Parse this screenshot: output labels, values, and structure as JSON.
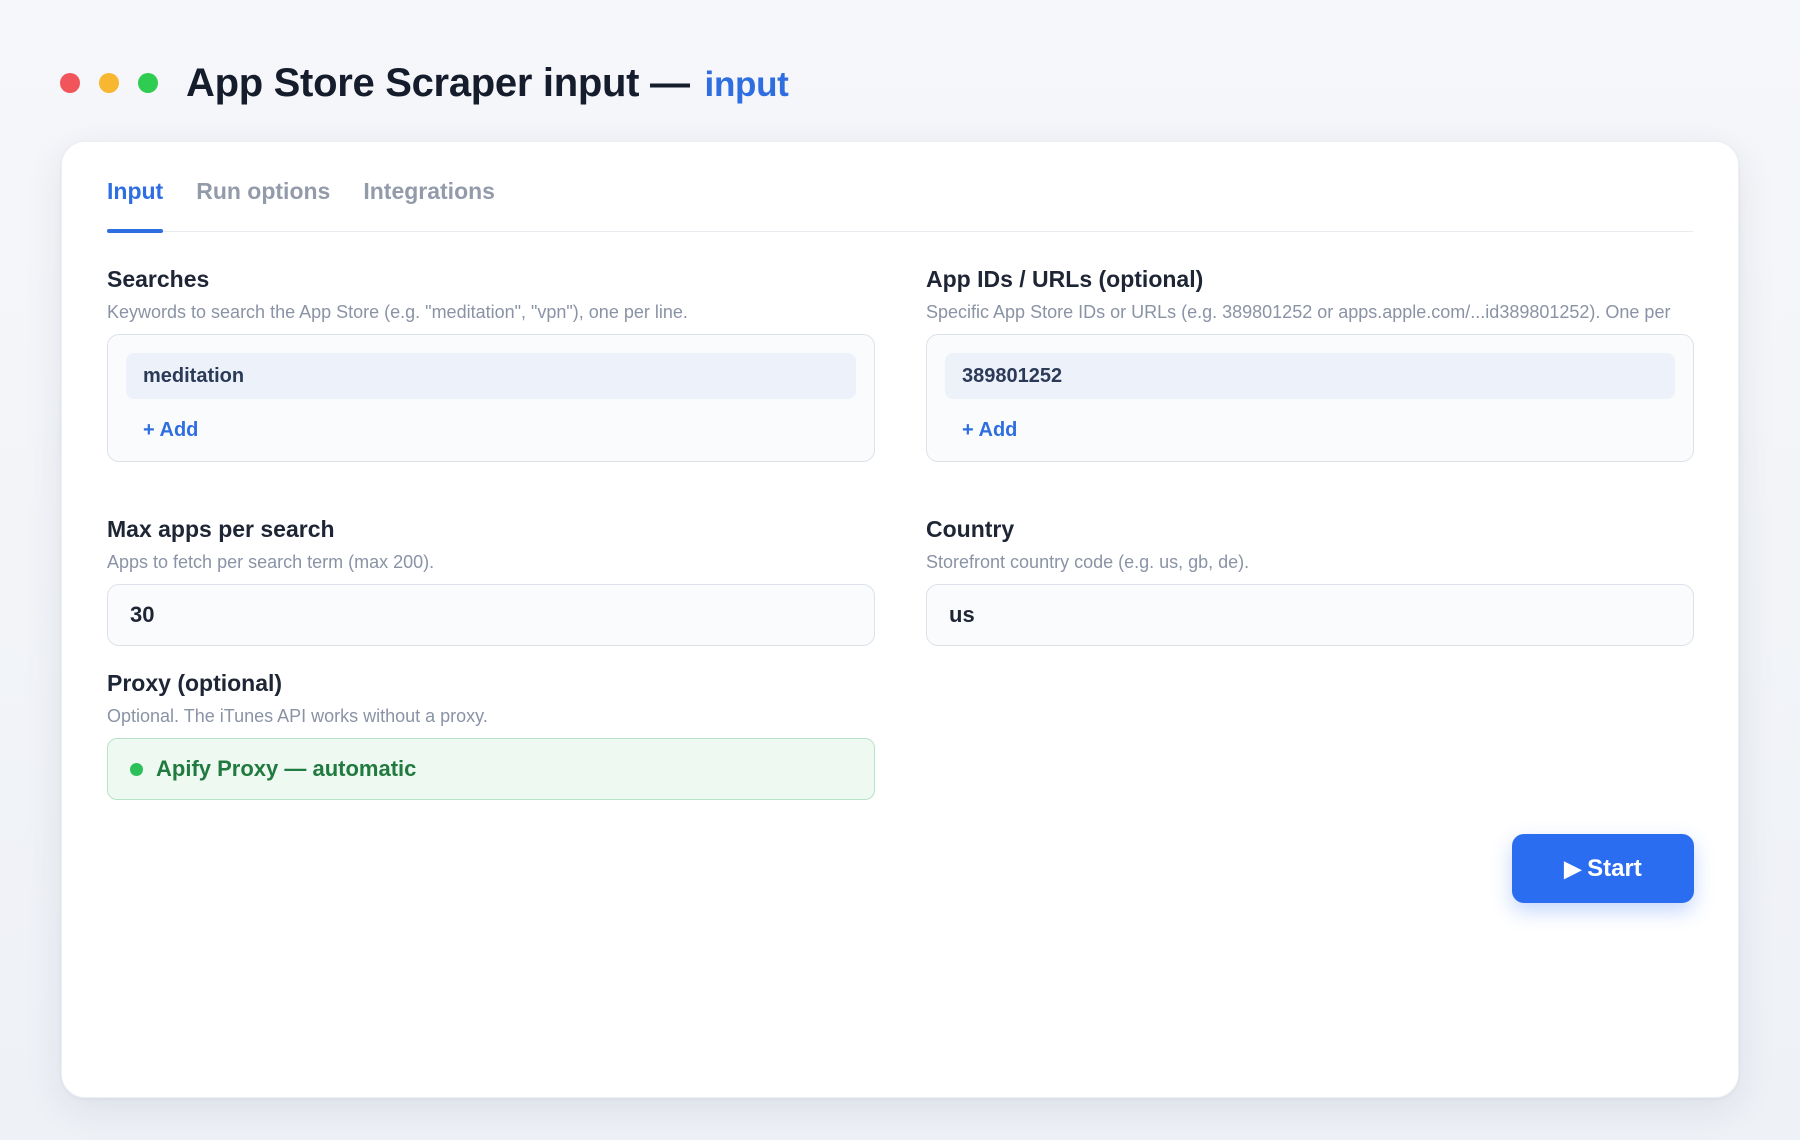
{
  "window": {
    "title": "App Store Scraper input —",
    "subtitle": "input"
  },
  "tabs": [
    {
      "label": "Input",
      "active": true
    },
    {
      "label": "Run options",
      "active": false
    },
    {
      "label": "Integrations",
      "active": false
    }
  ],
  "searches": {
    "label": "Searches",
    "help": "Keywords to search the App Store (e.g. \"meditation\", \"vpn\"), one per line.",
    "items": [
      "meditation"
    ],
    "add_label": "+ Add"
  },
  "app_ids": {
    "label": "App IDs / URLs (optional)",
    "help": "Specific App Store IDs or URLs (e.g. 389801252 or apps.apple.com/...id389801252). One per",
    "items": [
      "389801252"
    ],
    "add_label": "+ Add"
  },
  "max_apps": {
    "label": "Max apps per search",
    "help": "Apps to fetch per search term (max 200).",
    "value": "30"
  },
  "country": {
    "label": "Country",
    "help": "Storefront country code (e.g. us, gb, de).",
    "value": "us"
  },
  "proxy": {
    "label": "Proxy (optional)",
    "help": "Optional. The iTunes API works without a proxy.",
    "value": "Apify Proxy — automatic",
    "status_color": "#2cc05a"
  },
  "start_button": {
    "icon": "play-icon",
    "glyph": "▶",
    "label": "Start"
  },
  "colors": {
    "accent": "#2f6ee0",
    "button": "#2a6df0"
  }
}
